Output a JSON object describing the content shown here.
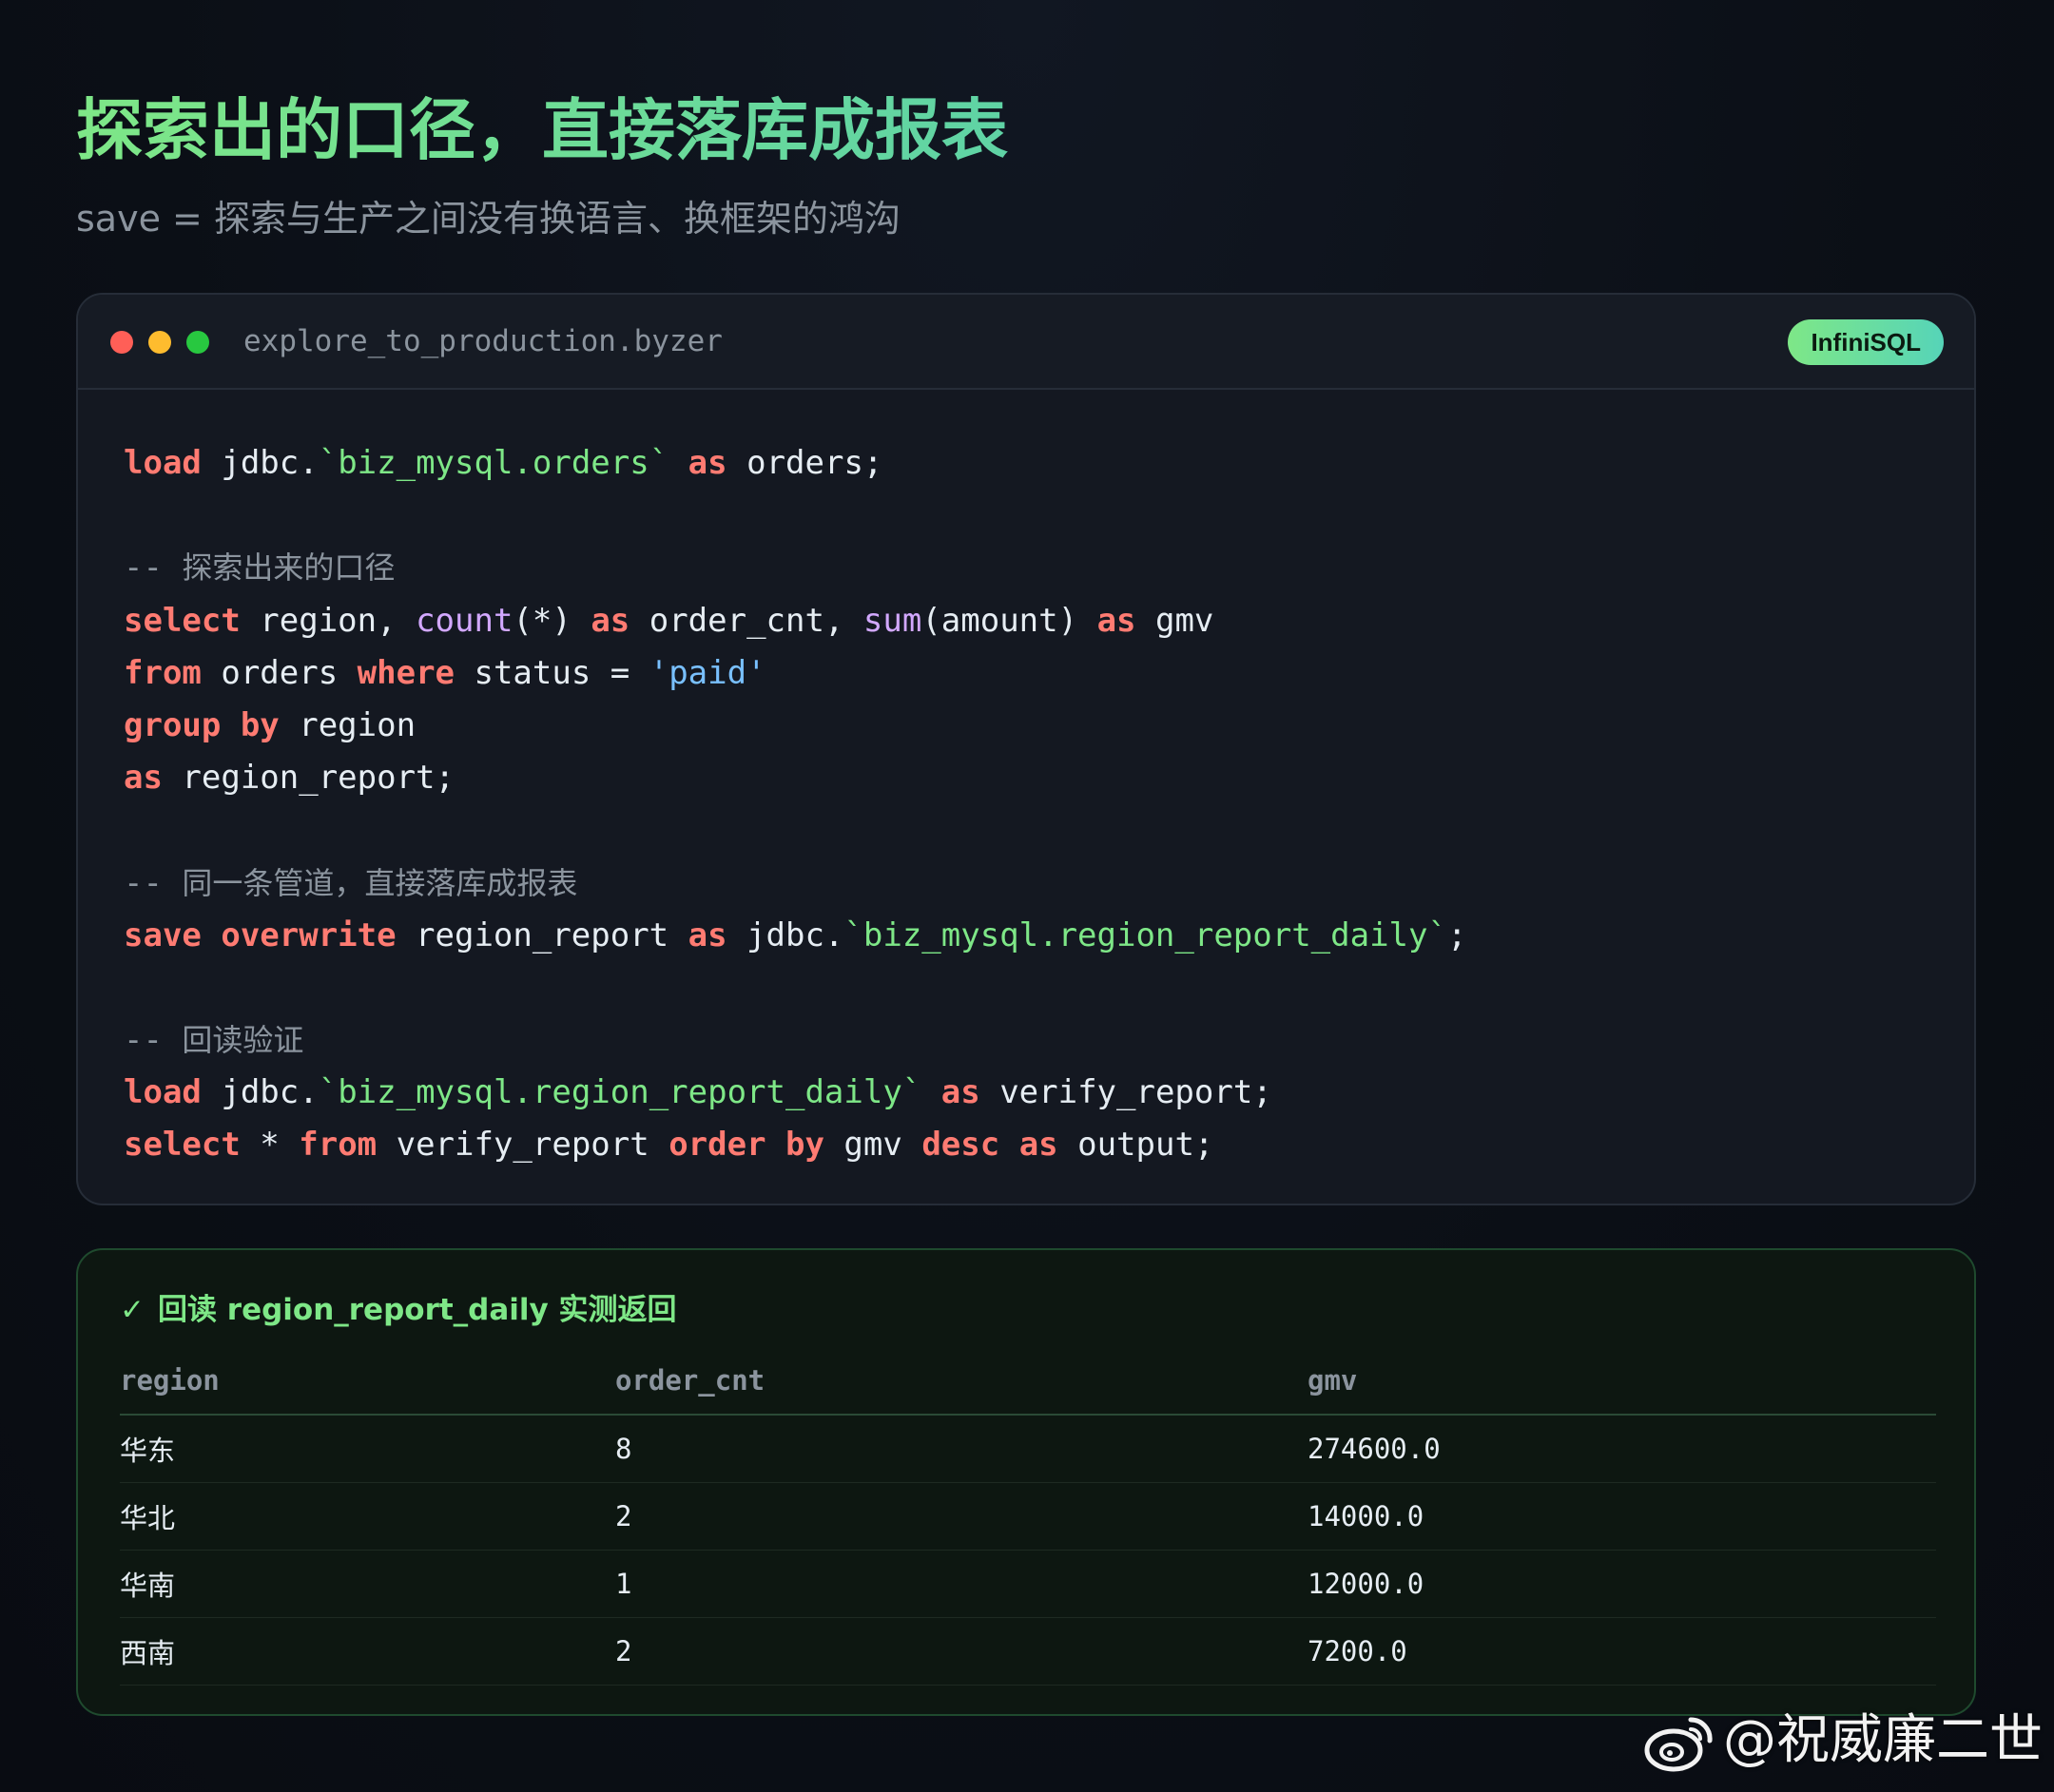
{
  "title": "探索出的口径，直接落库成报表",
  "subtitle": "save = 探索与生产之间没有换语言、换框架的鸿沟",
  "code_window": {
    "file_name": "explore_to_production.byzer",
    "badge": "InfiniSQL",
    "colors": {
      "keyword": "#ff7b72",
      "function": "#d2a8ff",
      "identifier_string": "#7ee787",
      "literal": "#79c0ff",
      "comment": "#8b949e"
    },
    "lines": [
      [
        {
          "t": "kw",
          "v": "load"
        },
        {
          "t": "p",
          "v": " jdbc."
        },
        {
          "t": "str",
          "v": "`biz_mysql.orders`"
        },
        {
          "t": "p",
          "v": " "
        },
        {
          "t": "kw",
          "v": "as"
        },
        {
          "t": "p",
          "v": " orders;"
        }
      ],
      [],
      [
        {
          "t": "cmd",
          "v": "-- "
        },
        {
          "t": "cm",
          "v": "探索出来的口径"
        }
      ],
      [
        {
          "t": "kw",
          "v": "select"
        },
        {
          "t": "p",
          "v": " region, "
        },
        {
          "t": "fn",
          "v": "count"
        },
        {
          "t": "p",
          "v": "(*) "
        },
        {
          "t": "kw",
          "v": "as"
        },
        {
          "t": "p",
          "v": " order_cnt, "
        },
        {
          "t": "fn",
          "v": "sum"
        },
        {
          "t": "p",
          "v": "(amount) "
        },
        {
          "t": "kw",
          "v": "as"
        },
        {
          "t": "p",
          "v": " gmv"
        }
      ],
      [
        {
          "t": "kw",
          "v": "from"
        },
        {
          "t": "p",
          "v": " orders "
        },
        {
          "t": "kw",
          "v": "where"
        },
        {
          "t": "p",
          "v": " status = "
        },
        {
          "t": "lit",
          "v": "'paid'"
        }
      ],
      [
        {
          "t": "kw",
          "v": "group by"
        },
        {
          "t": "p",
          "v": " region"
        }
      ],
      [
        {
          "t": "kw",
          "v": "as"
        },
        {
          "t": "p",
          "v": " region_report;"
        }
      ],
      [],
      [
        {
          "t": "cmd",
          "v": "-- "
        },
        {
          "t": "cm",
          "v": "同一条管道，直接落库成报表"
        }
      ],
      [
        {
          "t": "kw",
          "v": "save overwrite"
        },
        {
          "t": "p",
          "v": " region_report "
        },
        {
          "t": "kw",
          "v": "as"
        },
        {
          "t": "p",
          "v": " jdbc."
        },
        {
          "t": "str",
          "v": "`biz_mysql.region_report_daily`"
        },
        {
          "t": "p",
          "v": ";"
        }
      ],
      [],
      [
        {
          "t": "cmd",
          "v": "-- "
        },
        {
          "t": "cm",
          "v": "回读验证"
        }
      ],
      [
        {
          "t": "kw",
          "v": "load"
        },
        {
          "t": "p",
          "v": " jdbc."
        },
        {
          "t": "str",
          "v": "`biz_mysql.region_report_daily`"
        },
        {
          "t": "p",
          "v": " "
        },
        {
          "t": "kw",
          "v": "as"
        },
        {
          "t": "p",
          "v": " verify_report;"
        }
      ],
      [
        {
          "t": "kw",
          "v": "select"
        },
        {
          "t": "p",
          "v": " * "
        },
        {
          "t": "kw",
          "v": "from"
        },
        {
          "t": "p",
          "v": " verify_report "
        },
        {
          "t": "kw",
          "v": "order by"
        },
        {
          "t": "p",
          "v": " gmv "
        },
        {
          "t": "kw",
          "v": "desc"
        },
        {
          "t": "p",
          "v": " "
        },
        {
          "t": "kw",
          "v": "as"
        },
        {
          "t": "p",
          "v": " output;"
        }
      ]
    ]
  },
  "result": {
    "check_icon": "✓",
    "heading": "回读 region_report_daily 实测返回",
    "columns": [
      "region",
      "order_cnt",
      "gmv"
    ],
    "rows": [
      [
        "华东",
        "8",
        "274600.0"
      ],
      [
        "华北",
        "2",
        "14000.0"
      ],
      [
        "华南",
        "1",
        "12000.0"
      ],
      [
        "西南",
        "2",
        "7200.0"
      ]
    ]
  },
  "watermark": {
    "icon": "weibo-icon",
    "text": "@祝威廉二世"
  }
}
